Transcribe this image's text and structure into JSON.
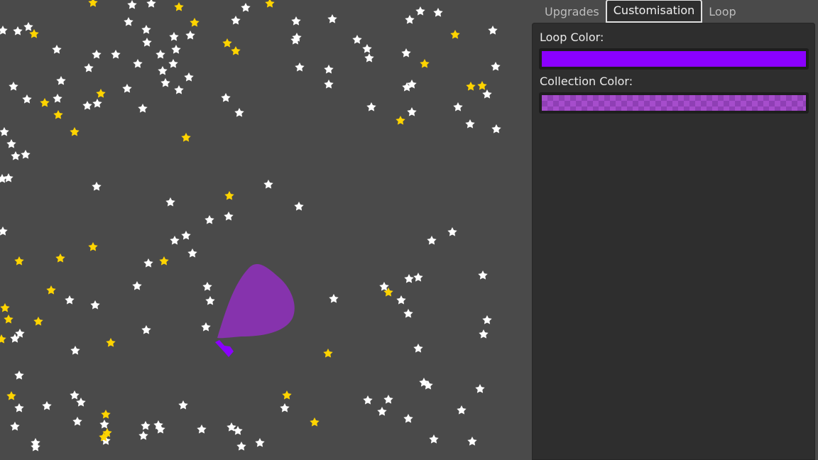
{
  "tabs": [
    {
      "label": "Upgrades",
      "active": false
    },
    {
      "label": "Customisation",
      "active": true
    },
    {
      "label": "Loop",
      "active": false
    }
  ],
  "customisation": {
    "loop_color_label": "Loop Color:",
    "loop_color": "#8a00ff",
    "collection_color_label": "Collection Color:",
    "collection_color": "#a64dcc",
    "collection_color_alt": "#8f3fb5"
  },
  "game": {
    "background": "#4a4a4a",
    "star_white": "#ffffff",
    "star_gold": "#ffd400",
    "blob_color": "#8633ad"
  }
}
